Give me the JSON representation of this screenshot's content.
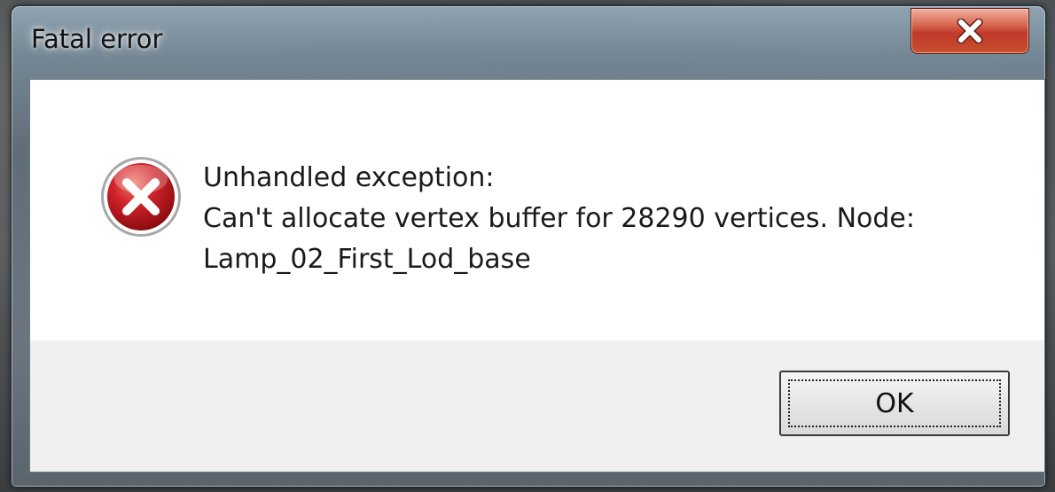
{
  "window": {
    "title": "Fatal error"
  },
  "icons": {
    "close": "close-icon",
    "error": "error-icon"
  },
  "message": {
    "line1": "Unhandled exception:",
    "line2": "Can't allocate vertex buffer for 28290 vertices. Node:",
    "line3": "Lamp_02_First_Lod_base"
  },
  "buttons": {
    "ok_label": "OK"
  },
  "colors": {
    "close_button": "#c0392b",
    "error_icon": "#c4161c",
    "client_bg": "#ffffff",
    "button_area_bg": "#f0f0f0"
  }
}
